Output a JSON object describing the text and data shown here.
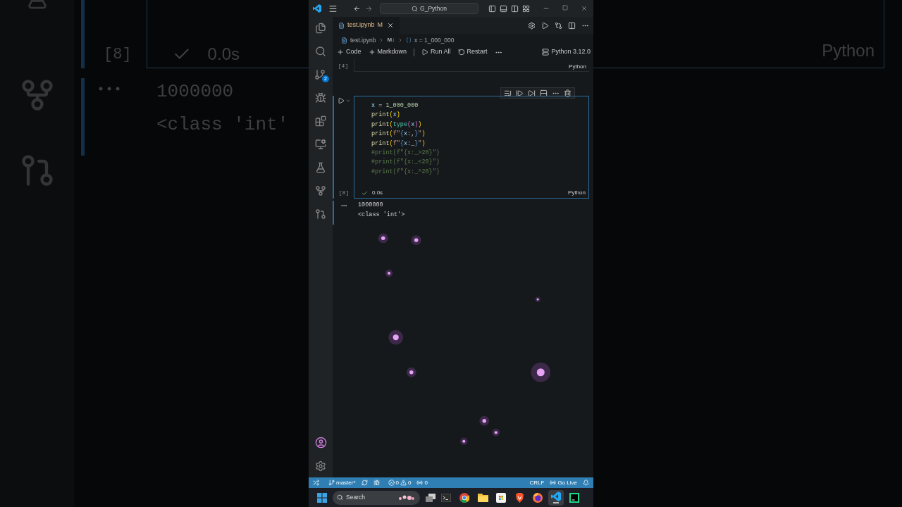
{
  "backdrop": {
    "left": {
      "cell_number": "[8]",
      "duration": "0.0s",
      "output_lines": [
        "1000000",
        "<class 'int'"
      ]
    },
    "right": {
      "language": "Python"
    }
  },
  "window": {
    "search": "G_Python"
  },
  "activity_bar": {
    "source_control_badge": "2"
  },
  "tab": {
    "title": "test.ipynb",
    "status": "M"
  },
  "breadcrumb": [
    "test.ipynb",
    "M↓",
    "x = 1_000_000"
  ],
  "toolbar": {
    "buttons": [
      {
        "kind": "add",
        "label": "Code"
      },
      {
        "kind": "add",
        "label": "Markdown"
      },
      {
        "kind": "run",
        "label": "Run All"
      },
      {
        "kind": "restart",
        "label": "Restart"
      }
    ],
    "kernel": "Python 3.12.0"
  },
  "cells": [
    {
      "execution_count": "[4]",
      "language": "Python",
      "focused": false
    },
    {
      "execution_count": "[8]",
      "language": "Python",
      "focused": true,
      "status": "0.0s",
      "code": [
        [
          {
            "t": "x",
            "kind": "var"
          },
          {
            "t": " = ",
            "kind": "op"
          },
          {
            "t": "1_000_000",
            "kind": "num"
          }
        ],
        [
          {
            "t": "print",
            "kind": "fn"
          },
          {
            "t": "(",
            "kind": "paren"
          },
          {
            "t": "x",
            "kind": "var"
          },
          {
            "t": ")",
            "kind": "paren"
          }
        ],
        [
          {
            "t": "print",
            "kind": "fn"
          },
          {
            "t": "(",
            "kind": "paren"
          },
          {
            "t": "type",
            "kind": "type"
          },
          {
            "t": "(",
            "kind": "paren2"
          },
          {
            "t": "x",
            "kind": "var"
          },
          {
            "t": ")",
            "kind": "paren2"
          },
          {
            "t": ")",
            "kind": "paren"
          }
        ],
        [
          {
            "t": "print",
            "kind": "fn"
          },
          {
            "t": "(",
            "kind": "paren"
          },
          {
            "t": "f\"",
            "kind": "str"
          },
          {
            "t": "{",
            "kind": "brace"
          },
          {
            "t": "x",
            "kind": "var"
          },
          {
            "t": ":,",
            "kind": "op"
          },
          {
            "t": "}",
            "kind": "brace"
          },
          {
            "t": "\"",
            "kind": "str"
          },
          {
            "t": ")",
            "kind": "paren"
          }
        ],
        [
          {
            "t": "print",
            "kind": "fn"
          },
          {
            "t": "(",
            "kind": "paren"
          },
          {
            "t": "f\"",
            "kind": "str"
          },
          {
            "t": "{",
            "kind": "brace"
          },
          {
            "t": "x",
            "kind": "var"
          },
          {
            "t": ":_",
            "kind": "op"
          },
          {
            "t": "}",
            "kind": "brace"
          },
          {
            "t": "\"",
            "kind": "str"
          },
          {
            "t": ")",
            "kind": "paren"
          }
        ],
        [
          {
            "t": "#print(f\"{x:_>20}\")",
            "kind": "comment"
          }
        ],
        [
          {
            "t": "#print(f\"{x:_<20}\")",
            "kind": "comment"
          }
        ],
        [
          {
            "t": "#print(f\"{x:_^20}\")",
            "kind": "comment"
          }
        ]
      ],
      "output": [
        "1000000",
        "<class 'int'>"
      ]
    }
  ],
  "status_bar": {
    "branch": "master*",
    "errors": "0",
    "warnings": "0",
    "ports": "0",
    "line_ending": "CRLF",
    "live": "Go Live"
  },
  "taskbar": {
    "search": "Search",
    "apps": [
      {
        "kind": "windows",
        "active": false
      },
      {
        "kind": "terminal",
        "active": false
      },
      {
        "kind": "chrome",
        "active": false
      },
      {
        "kind": "folder",
        "active": false
      },
      {
        "kind": "store",
        "active": false
      },
      {
        "kind": "brave",
        "active": false
      },
      {
        "kind": "firefox",
        "active": false
      },
      {
        "kind": "vscode",
        "active": true
      },
      {
        "kind": "pycharm",
        "active": false
      }
    ]
  }
}
